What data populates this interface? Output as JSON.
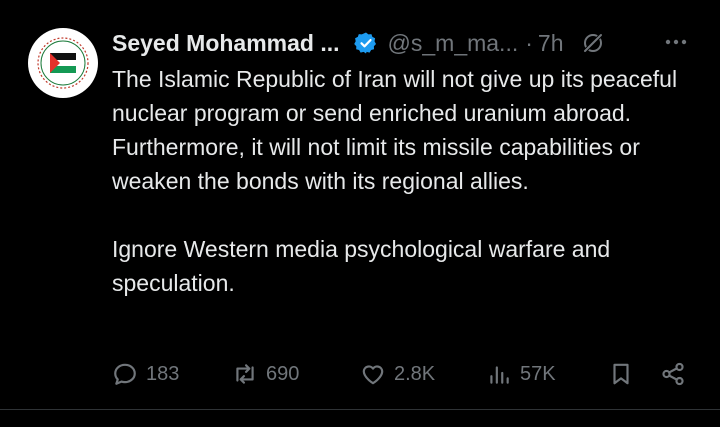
{
  "author": {
    "display_name": "Seyed Mohammad ...",
    "handle": "@s_m_ma...",
    "separator": "·",
    "time": "7h",
    "verified": true
  },
  "tweet": {
    "paragraph1": "The Islamic Republic of Iran will not give up its peaceful nuclear program or send enriched uranium abroad. Furthermore, it will not limit its missile capabilities or weaken the bonds with its regional allies.",
    "paragraph2": "Ignore Western media psychological warfare and speculation."
  },
  "actions": {
    "replies": "183",
    "reposts": "690",
    "likes": "2.8K",
    "views": "57K"
  },
  "icons": {
    "verified": "verified-badge-icon",
    "grok": "grok-icon",
    "more": "more-icon",
    "reply": "reply-icon",
    "repost": "repost-icon",
    "like": "heart-icon",
    "views": "views-icon",
    "bookmark": "bookmark-icon",
    "share": "share-icon"
  },
  "colors": {
    "background": "#000000",
    "text": "#e7e9ea",
    "muted": "#71767b",
    "verified": "#1d9bf0"
  }
}
